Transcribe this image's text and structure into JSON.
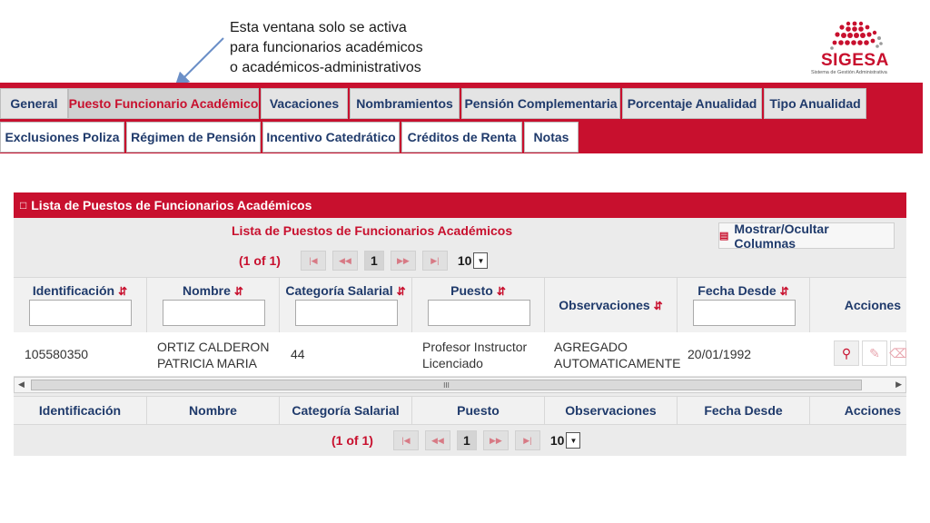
{
  "annotation": {
    "lines": [
      "Esta ventana solo se activa",
      "para funcionarios académicos",
      "o académicos-administrativos"
    ]
  },
  "logo": {
    "name": "SIGESA",
    "subtitle": "Sistema de Gestión Administrativa"
  },
  "tabs": {
    "row1": [
      "General",
      "Puesto Funcionario Académico",
      "Vacaciones",
      "Nombramientos",
      "Pensión Complementaria",
      "Porcentaje Anualidad",
      "Tipo Anualidad"
    ],
    "row2": [
      "Exclusiones Poliza",
      "Régimen de Pensión",
      "Incentivo Catedrático",
      "Créditos de Renta",
      "Notas"
    ],
    "active": "Puesto Funcionario Académico"
  },
  "panel": {
    "header": "Lista de Puestos de Funcionarios Académicos",
    "grid_title": "Lista de Puestos de Funcionarios Académicos",
    "toggle_columns": "Mostrar/Ocultar Columnas",
    "paginator": {
      "count": "(1 of 1)",
      "page": "1",
      "rows_per_page": "10"
    },
    "columns": [
      "Identificación",
      "Nombre",
      "Categoría Salarial",
      "Puesto",
      "Observaciones",
      "Fecha Desde",
      "Acciones"
    ],
    "rows": [
      {
        "identificacion": "105580350",
        "nombre": [
          "ORTIZ CALDERON",
          "PATRICIA MARIA"
        ],
        "categoria": "44",
        "puesto": [
          "Profesor Instructor",
          "Licenciado"
        ],
        "observaciones": [
          "AGREGADO",
          "AUTOMATICAMENTE"
        ],
        "fecha_desde": "20/01/1992"
      }
    ],
    "scrollbar_grip": "III"
  },
  "colors": {
    "brand_red": "#c8102e",
    "text_blue": "#1f3a6b",
    "tab_gray": "#e4e4e4"
  },
  "icons": {
    "sort": "sort-icon",
    "first": "first-page-icon",
    "prev": "prev-page-icon",
    "next": "next-page-icon",
    "last": "last-page-icon",
    "view": "magnifier-icon",
    "edit": "pencil-icon",
    "delete": "trash-icon"
  }
}
